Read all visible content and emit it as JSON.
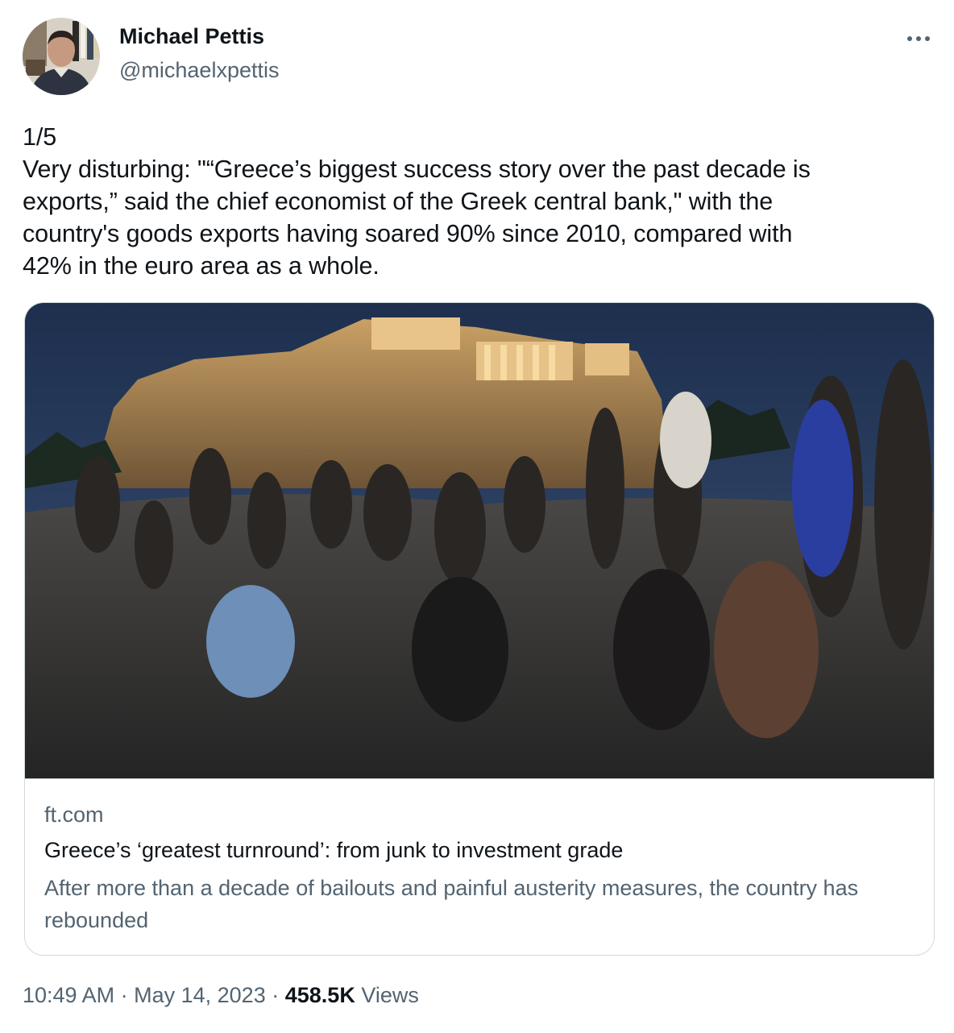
{
  "author": {
    "name": "Michael Pettis",
    "handle": "@michaelxpettis"
  },
  "tweet": {
    "lines": [
      "1/5",
      "Very disturbing: \"“Greece’s biggest success story over the past decade is",
      "exports,” said the chief economist of the Greek central bank,\" with the",
      "country's goods exports having soared 90% since 2010, compared with",
      "42% in the euro area as a whole."
    ]
  },
  "card": {
    "domain": "ft.com",
    "title": "Greece’s ‘greatest turnround’: from junk to investment grade",
    "description": "After more than a decade of bailouts and painful austerity measures, the country has rebounded"
  },
  "meta": {
    "time": "10:49 AM",
    "separator": "·",
    "date": "May 14, 2023",
    "views_count": "458.5K",
    "views_label": "Views"
  },
  "icons": {
    "more": "more-horizontal-icon"
  },
  "colors": {
    "text_primary": "#0f1419",
    "text_secondary": "#536471",
    "border": "#cfd9de"
  }
}
